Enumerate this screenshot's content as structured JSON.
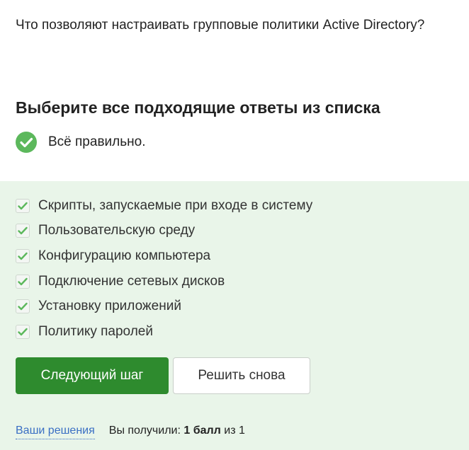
{
  "question": "Что позволяют настраивать групповые политики Active Directory?",
  "instruction": "Выберите все подходящие ответы из списка",
  "result": {
    "text": "Всё правильно.",
    "icon": "check-circle-icon",
    "color": "#5cb85c"
  },
  "options": [
    {
      "label": "Скрипты, запускаемые при входе в систему",
      "checked": true
    },
    {
      "label": "Пользовательскую среду",
      "checked": true
    },
    {
      "label": "Конфигурацию компьютера",
      "checked": true
    },
    {
      "label": "Подключение сетевых дисков",
      "checked": true
    },
    {
      "label": "Установку приложений",
      "checked": true
    },
    {
      "label": "Политику паролей",
      "checked": true
    }
  ],
  "buttons": {
    "next_step": "Следующий шаг",
    "solve_again": "Решить снова"
  },
  "footer": {
    "solutions_link": "Ваши решения",
    "score_prefix": "Вы получили: ",
    "score_value": "1 балл",
    "score_suffix": " из 1"
  },
  "colors": {
    "panel_background": "#e9f5e9",
    "primary_button": "#2e8b2e",
    "link": "#3a6fc4",
    "checkmark": "#5cb85c"
  }
}
